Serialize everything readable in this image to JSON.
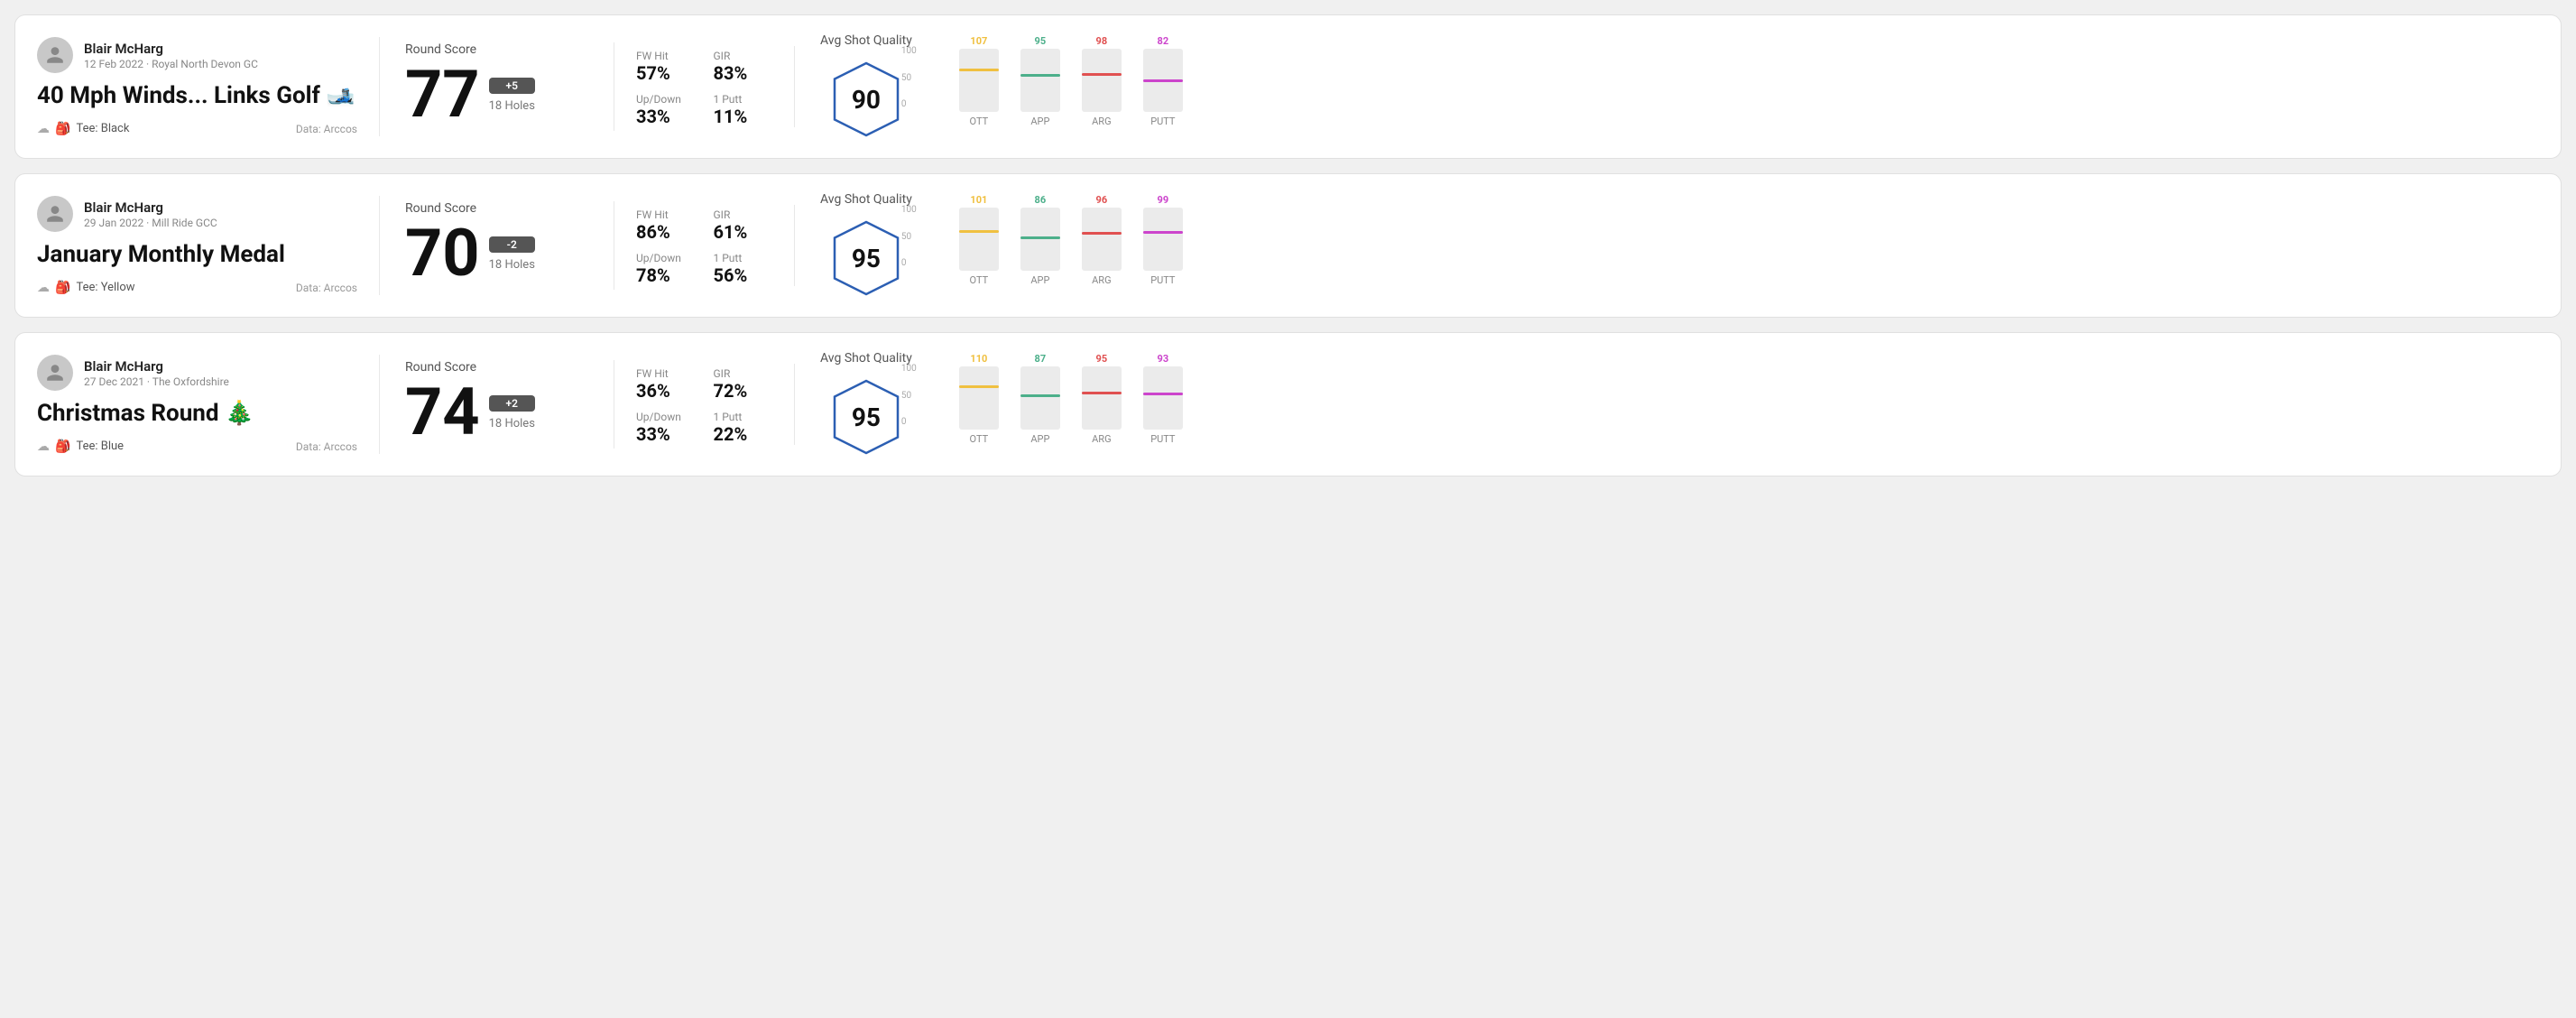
{
  "rounds": [
    {
      "id": "round1",
      "user": "Blair McHarg",
      "date": "12 Feb 2022",
      "course": "Royal North Devon GC",
      "title": "40 Mph Winds... Links Golf 🎿",
      "tee": "Black",
      "data_source": "Data: Arccos",
      "score": "77",
      "score_diff": "+5",
      "holes": "18 Holes",
      "fw_hit": "57%",
      "gir": "83%",
      "up_down": "33%",
      "one_putt": "11%",
      "avg_quality": "90",
      "chart": {
        "ott": {
          "value": 107,
          "color": "#f0c040",
          "height_pct": 68
        },
        "app": {
          "value": 95,
          "color": "#4caf8a",
          "height_pct": 60
        },
        "arg": {
          "value": 98,
          "color": "#e05050",
          "height_pct": 62
        },
        "putt": {
          "value": 82,
          "color": "#cc44cc",
          "height_pct": 52
        }
      }
    },
    {
      "id": "round2",
      "user": "Blair McHarg",
      "date": "29 Jan 2022",
      "course": "Mill Ride GCC",
      "title": "January Monthly Medal",
      "tee": "Yellow",
      "data_source": "Data: Arccos",
      "score": "70",
      "score_diff": "-2",
      "holes": "18 Holes",
      "fw_hit": "86%",
      "gir": "61%",
      "up_down": "78%",
      "one_putt": "56%",
      "avg_quality": "95",
      "chart": {
        "ott": {
          "value": 101,
          "color": "#f0c040",
          "height_pct": 64
        },
        "app": {
          "value": 86,
          "color": "#4caf8a",
          "height_pct": 54
        },
        "arg": {
          "value": 96,
          "color": "#e05050",
          "height_pct": 61
        },
        "putt": {
          "value": 99,
          "color": "#cc44cc",
          "height_pct": 63
        }
      }
    },
    {
      "id": "round3",
      "user": "Blair McHarg",
      "date": "27 Dec 2021",
      "course": "The Oxfordshire",
      "title": "Christmas Round 🎄",
      "tee": "Blue",
      "data_source": "Data: Arccos",
      "score": "74",
      "score_diff": "+2",
      "holes": "18 Holes",
      "fw_hit": "36%",
      "gir": "72%",
      "up_down": "33%",
      "one_putt": "22%",
      "avg_quality": "95",
      "chart": {
        "ott": {
          "value": 110,
          "color": "#f0c040",
          "height_pct": 70
        },
        "app": {
          "value": 87,
          "color": "#4caf8a",
          "height_pct": 55
        },
        "arg": {
          "value": 95,
          "color": "#e05050",
          "height_pct": 60
        },
        "putt": {
          "value": 93,
          "color": "#cc44cc",
          "height_pct": 59
        }
      }
    }
  ],
  "labels": {
    "round_score": "Round Score",
    "fw_hit": "FW Hit",
    "gir": "GIR",
    "up_down": "Up/Down",
    "one_putt": "1 Putt",
    "avg_shot_quality": "Avg Shot Quality",
    "data": "Data: Arccos",
    "tee_prefix": "Tee:",
    "ott": "OTT",
    "app": "APP",
    "arg": "ARG",
    "putt": "PUTT",
    "y100": "100",
    "y50": "50",
    "y0": "0"
  }
}
